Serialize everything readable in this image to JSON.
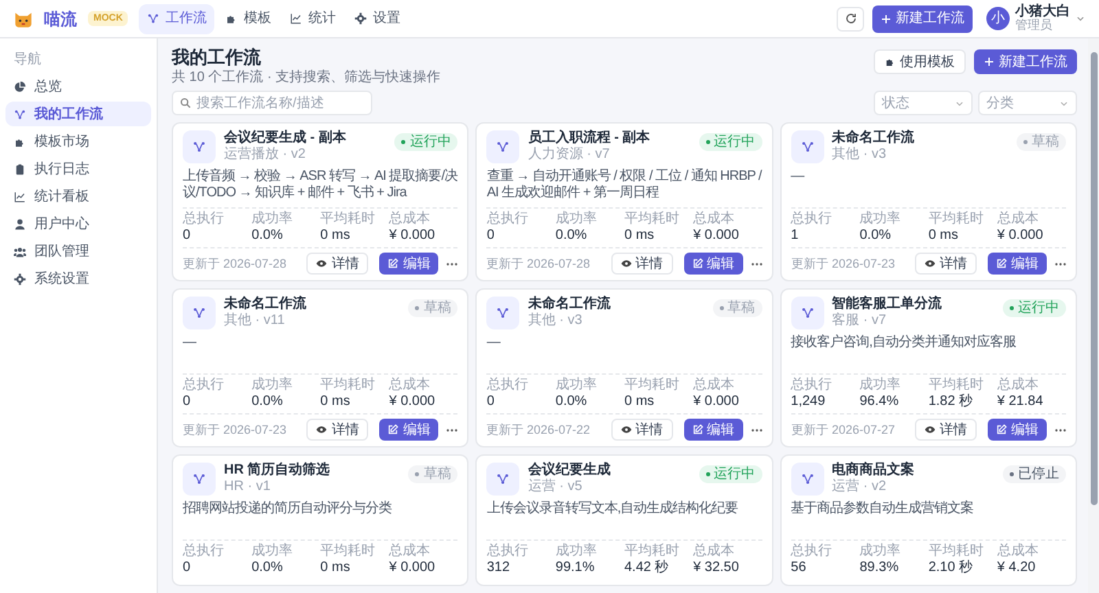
{
  "header": {
    "brand": "喵流",
    "badge": "MOCK",
    "tabs": [
      {
        "label": "工作流",
        "selected": true
      },
      {
        "label": "模板",
        "selected": false
      },
      {
        "label": "统计",
        "selected": false
      },
      {
        "label": "设置",
        "selected": false
      }
    ],
    "new_button": "新建工作流",
    "user": {
      "avatar": "小",
      "name": "小猪大白",
      "role": "管理员"
    }
  },
  "sidebar": {
    "heading": "导航",
    "items": [
      {
        "label": "总览",
        "selected": false
      },
      {
        "label": "我的工作流",
        "selected": true
      },
      {
        "label": "模板市场",
        "selected": false
      },
      {
        "label": "执行日志",
        "selected": false
      },
      {
        "label": "统计看板",
        "selected": false
      },
      {
        "label": "用户中心",
        "selected": false
      },
      {
        "label": "团队管理",
        "selected": false
      },
      {
        "label": "系统设置",
        "selected": false
      }
    ]
  },
  "page": {
    "title": "我的工作流",
    "subtitle": "共 10 个工作流 · 支持搜索、筛选与快速操作",
    "template_button": "使用模板",
    "new_button": "新建工作流",
    "search": {
      "placeholder": "搜索工作流名称/描述"
    },
    "filters": [
      {
        "placeholder": "状态"
      },
      {
        "placeholder": "分类"
      }
    ]
  },
  "cards": [
    {
      "name": "会议纪要生成 - 副本",
      "meta": "运营播放 · v2",
      "status": {
        "kind": "running",
        "label": "运行中"
      },
      "description": "上传音频 → 校验 → ASR 转写 → AI 提取摘要/决议/TODO → 知识库 + 邮件 + 飞书 + Jira",
      "stats": [
        {
          "label": "总执行",
          "value": "0"
        },
        {
          "label": "成功率",
          "value": "0.0%"
        },
        {
          "label": "平均耗时",
          "value": "0 ms"
        },
        {
          "label": "总成本",
          "value": "¥ 0.000"
        }
      ],
      "updated": "更新于 2026-07-28",
      "detail": "详情",
      "edit": "编辑"
    },
    {
      "name": "员工入职流程 - 副本",
      "meta": "人力资源 · v7",
      "status": {
        "kind": "running",
        "label": "运行中"
      },
      "description": "查重 → 自动开通账号 / 权限 / 工位 / 通知 HRBP / AI 生成欢迎邮件 + 第一周日程",
      "stats": [
        {
          "label": "总执行",
          "value": "0"
        },
        {
          "label": "成功率",
          "value": "0.0%"
        },
        {
          "label": "平均耗时",
          "value": "0 ms"
        },
        {
          "label": "总成本",
          "value": "¥ 0.000"
        }
      ],
      "updated": "更新于 2026-07-28",
      "detail": "详情",
      "edit": "编辑"
    },
    {
      "name": "未命名工作流",
      "meta": "其他 · v3",
      "status": {
        "kind": "draft",
        "label": "草稿"
      },
      "description": "—",
      "stats": [
        {
          "label": "总执行",
          "value": "1"
        },
        {
          "label": "成功率",
          "value": "0.0%"
        },
        {
          "label": "平均耗时",
          "value": "0 ms"
        },
        {
          "label": "总成本",
          "value": "¥ 0.000"
        }
      ],
      "updated": "更新于 2026-07-23",
      "detail": "详情",
      "edit": "编辑"
    },
    {
      "name": "未命名工作流",
      "meta": "其他 · v11",
      "status": {
        "kind": "draft",
        "label": "草稿"
      },
      "description": "—",
      "stats": [
        {
          "label": "总执行",
          "value": "0"
        },
        {
          "label": "成功率",
          "value": "0.0%"
        },
        {
          "label": "平均耗时",
          "value": "0 ms"
        },
        {
          "label": "总成本",
          "value": "¥ 0.000"
        }
      ],
      "updated": "更新于 2026-07-23",
      "detail": "详情",
      "edit": "编辑"
    },
    {
      "name": "未命名工作流",
      "meta": "其他 · v3",
      "status": {
        "kind": "draft",
        "label": "草稿"
      },
      "description": "—",
      "stats": [
        {
          "label": "总执行",
          "value": "0"
        },
        {
          "label": "成功率",
          "value": "0.0%"
        },
        {
          "label": "平均耗时",
          "value": "0 ms"
        },
        {
          "label": "总成本",
          "value": "¥ 0.000"
        }
      ],
      "updated": "更新于 2026-07-22",
      "detail": "详情",
      "edit": "编辑"
    },
    {
      "name": "智能客服工单分流",
      "meta": "客服 · v7",
      "status": {
        "kind": "running",
        "label": "运行中"
      },
      "description": "接收客户咨询,自动分类并通知对应客服",
      "stats": [
        {
          "label": "总执行",
          "value": "1,249"
        },
        {
          "label": "成功率",
          "value": "96.4%"
        },
        {
          "label": "平均耗时",
          "value": "1.82 秒"
        },
        {
          "label": "总成本",
          "value": "¥ 21.84"
        }
      ],
      "updated": "更新于 2026-07-27",
      "detail": "详情",
      "edit": "编辑"
    },
    {
      "name": "HR 简历自动筛选",
      "meta": "HR · v1",
      "status": {
        "kind": "draft",
        "label": "草稿"
      },
      "description": "招聘网站投递的简历自动评分与分类",
      "stats": [
        {
          "label": "总执行",
          "value": "0"
        },
        {
          "label": "成功率",
          "value": "0.0%"
        },
        {
          "label": "平均耗时",
          "value": "0 ms"
        },
        {
          "label": "总成本",
          "value": "¥ 0.000"
        }
      ]
    },
    {
      "name": "会议纪要生成",
      "meta": "运营 · v5",
      "status": {
        "kind": "running",
        "label": "运行中"
      },
      "description": "上传会议录音转写文本,自动生成结构化纪要",
      "stats": [
        {
          "label": "总执行",
          "value": "312"
        },
        {
          "label": "成功率",
          "value": "99.1%"
        },
        {
          "label": "平均耗时",
          "value": "4.42 秒"
        },
        {
          "label": "总成本",
          "value": "¥ 32.50"
        }
      ]
    },
    {
      "name": "电商商品文案",
      "meta": "运营 · v2",
      "status": {
        "kind": "stopped",
        "label": "已停止"
      },
      "description": "基于商品参数自动生成营销文案",
      "stats": [
        {
          "label": "总执行",
          "value": "56"
        },
        {
          "label": "成功率",
          "value": "89.3%"
        },
        {
          "label": "平均耗时",
          "value": "2.10 秒"
        },
        {
          "label": "总成本",
          "value": "¥ 4.20"
        }
      ]
    }
  ]
}
